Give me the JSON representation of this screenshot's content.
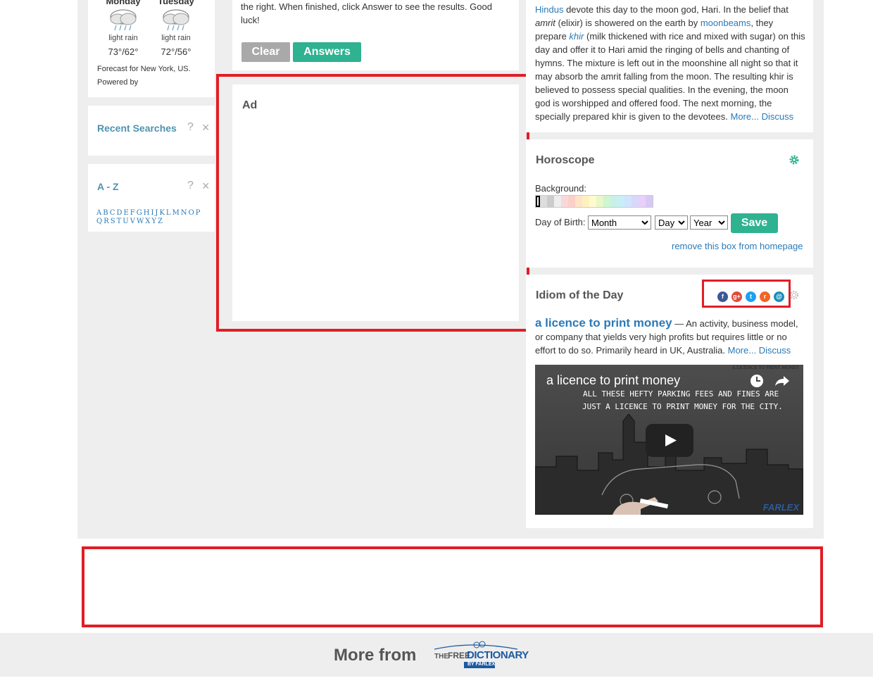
{
  "weather": {
    "days": [
      {
        "name": "Monday",
        "condition": "light rain",
        "temp": "73°/62°"
      },
      {
        "name": "Tuesday",
        "condition": "light rain",
        "temp": "72°/56°"
      }
    ],
    "forecast": "Forecast for New York, US.",
    "powered": "Powered by"
  },
  "recent_searches": {
    "title": "Recent Searches",
    "help": "?",
    "close": "×"
  },
  "az": {
    "title": "A - Z",
    "help": "?",
    "close": "×",
    "row1": [
      "A",
      "B",
      "C",
      "D",
      "E",
      "F",
      "G",
      "H",
      "I",
      "J",
      "K",
      "L",
      "M",
      "N",
      "O",
      "P"
    ],
    "row2": [
      "Q",
      "R",
      "S",
      "T",
      "U",
      "V",
      "W",
      "X",
      "Y",
      "Z"
    ]
  },
  "quiz": {
    "text": "the right. When finished, click Answer to see the results. Good luck!",
    "clear": "Clear",
    "answers": "Answers"
  },
  "ad": {
    "label": "Ad"
  },
  "holiday": {
    "hindus": "Hindus",
    "t1": " devote this day to the moon god, Hari. In the belief that ",
    "amrit": "amrit",
    "t2": " (elixir) is showered on the earth by ",
    "moonbeams": "moonbeams",
    "t3": ", they prepare ",
    "khir": "khir",
    "t4": " (milk thickened with rice and mixed with sugar) on this day and offer it to Hari amid the ringing of bells and chanting of hymns. The mixture is left out in the moonshine all night so that it may absorb the amrit falling from the moon. The resulting khir is believed to possess special qualities. In the evening, the moon god is worshipped and offered food. The next morning, the specially prepared khir is given to the devotees. ",
    "more": "More...",
    "discuss": "Discuss"
  },
  "horoscope": {
    "title": "Horoscope",
    "background_label": "Background:",
    "swatches": [
      "#000000",
      "#dddddd",
      "#cccccc",
      "#eeeeee",
      "#f8d8d8",
      "#fbd0c8",
      "#fde4c8",
      "#fff0c0",
      "#fffbd0",
      "#e8f8c8",
      "#d0f5d0",
      "#c8f0e8",
      "#c8eef8",
      "#d0e4fb",
      "#d8d8fb",
      "#e8d0f8",
      "#d8c8f5"
    ],
    "dob_label": "Day of Birth:",
    "month": "Month",
    "day": "Day",
    "year": "Year",
    "save": "Save",
    "remove": "remove this box from homepage"
  },
  "idiom": {
    "title": "Idiom of the Day",
    "phrase": "a licence to print money",
    "definition": " — An activity, business model, or company that yields very high profits but requires little or no effort to do so. Primarily heard in UK, Australia. ",
    "more": "More...",
    "discuss": "Discuss",
    "share": [
      {
        "icon": "facebook-icon",
        "glyph": "f",
        "color": "#3b5998"
      },
      {
        "icon": "google-plus-icon",
        "glyph": "g+",
        "color": "#dd4b39"
      },
      {
        "icon": "twitter-icon",
        "glyph": "t",
        "color": "#1da1f2"
      },
      {
        "icon": "rss-icon",
        "glyph": "r",
        "color": "#f26522"
      },
      {
        "icon": "mail-icon",
        "glyph": "@",
        "color": "#1b8dbb"
      }
    ],
    "video": {
      "title": "a licence to print money",
      "caption1": "ALL THESE HEFTY PARKING FEES AND FINES ARE",
      "caption2": "JUST A LICENCE TO PRINT MONEY FOR THE CITY.",
      "corner": "A LICENCE TO PRINT MONEY",
      "brand": "FARLEX"
    }
  },
  "footer": {
    "more_from": "More from",
    "logo_the": "THE",
    "logo_free": "FREE",
    "logo_dict": "DICTIONARY",
    "logo_by": "BY FARLEX"
  }
}
